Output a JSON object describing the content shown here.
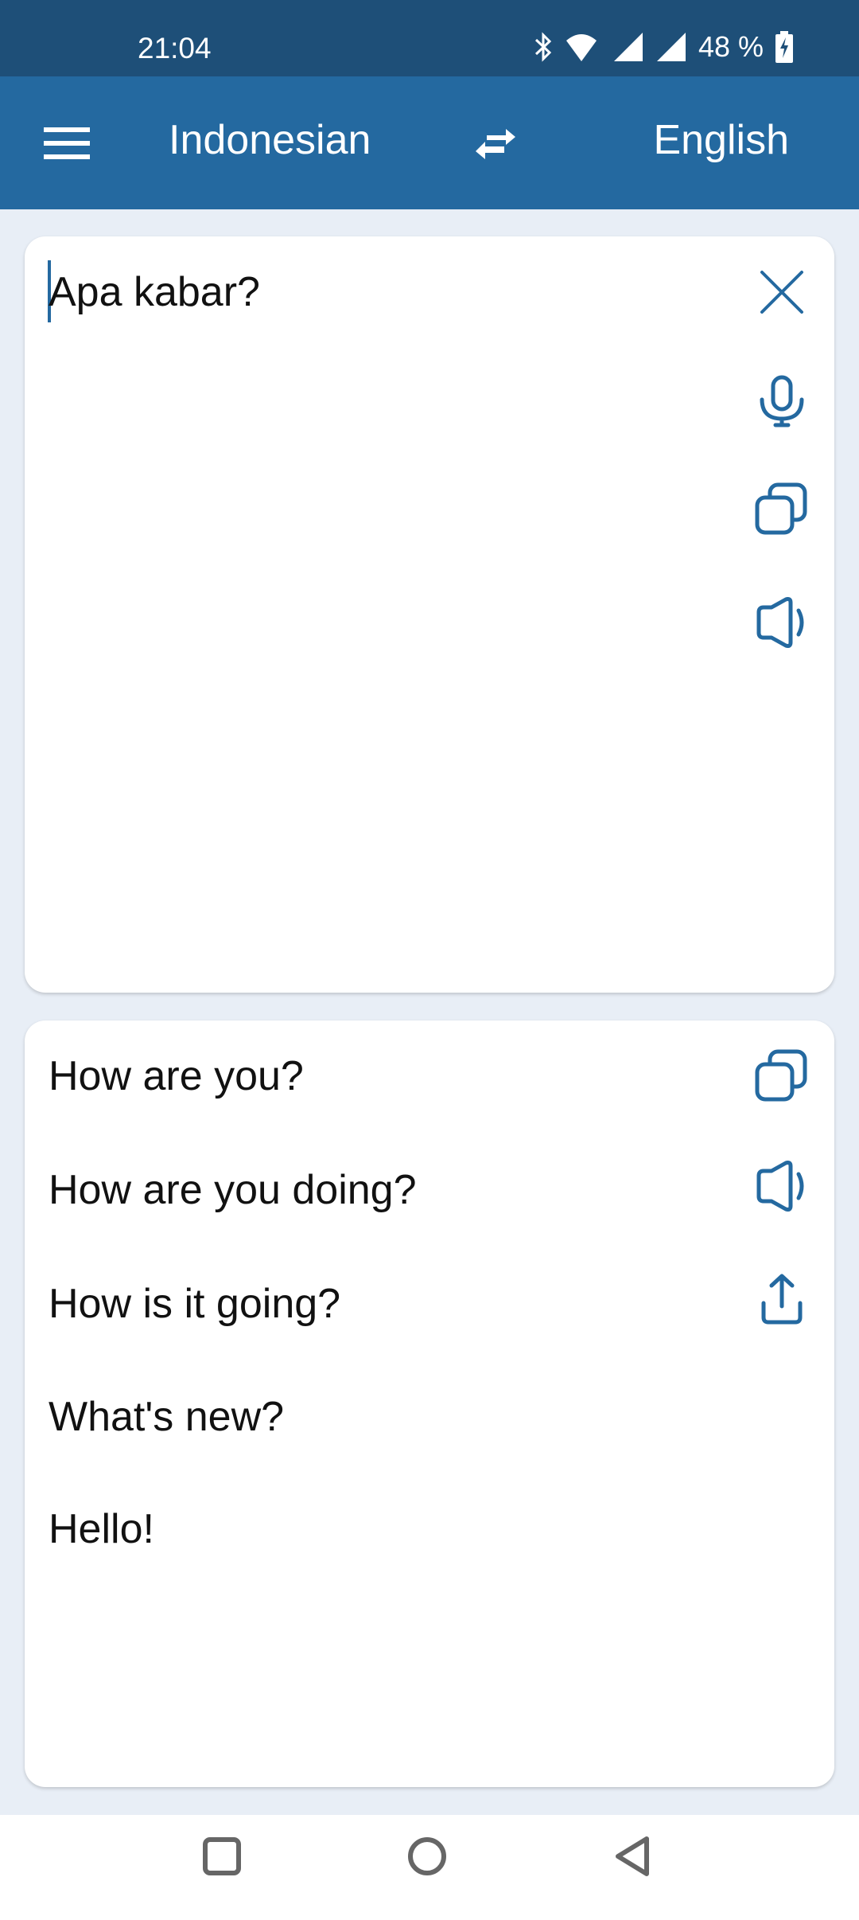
{
  "status_bar": {
    "time": "21:04",
    "battery": "48 %"
  },
  "app_bar": {
    "source_language": "Indonesian",
    "target_language": "English"
  },
  "input": {
    "text": "Apa kabar?"
  },
  "results": [
    "How are you?",
    "How are you doing?",
    "How is it going?",
    "What's new?",
    "Hello!"
  ],
  "colors": {
    "status_bar": "#1e4f78",
    "app_bar": "#2469a0",
    "accent": "#2469a0",
    "background": "#e8eef6"
  }
}
